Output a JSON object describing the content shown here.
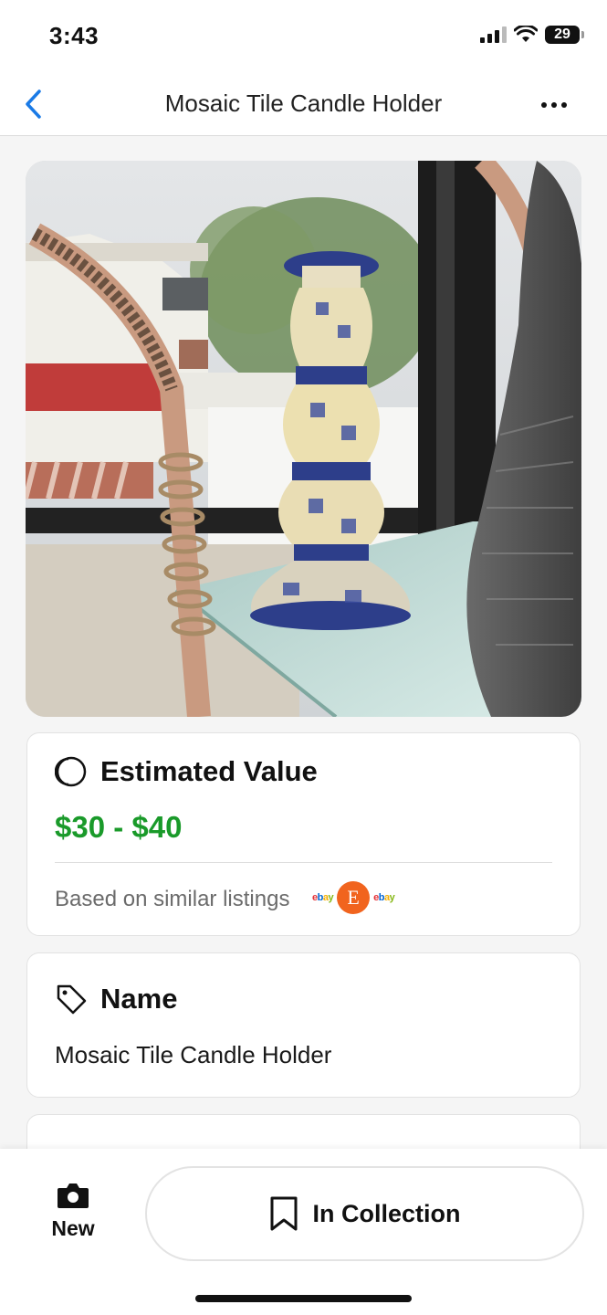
{
  "status_bar": {
    "time": "3:43",
    "battery": "29"
  },
  "nav": {
    "title": "Mosaic Tile Candle Holder",
    "back_icon": "chevron-left-icon",
    "more_icon": "ellipsis-icon"
  },
  "photo": {
    "subject": "mosaic-candle-holder-photo"
  },
  "estimated_value": {
    "title": "Estimated Value",
    "range": "$30 - $40",
    "basis": "Based on similar listings",
    "sources": [
      "ebay",
      "etsy",
      "ebay"
    ],
    "range_color": "#1a9a2a"
  },
  "name_card": {
    "title": "Name",
    "value": "Mosaic Tile Candle Holder"
  },
  "bottom_bar": {
    "new_label": "New",
    "collection_label": "In Collection"
  },
  "colors": {
    "accent": "#1a7ae6",
    "etsy": "#f1641e"
  }
}
